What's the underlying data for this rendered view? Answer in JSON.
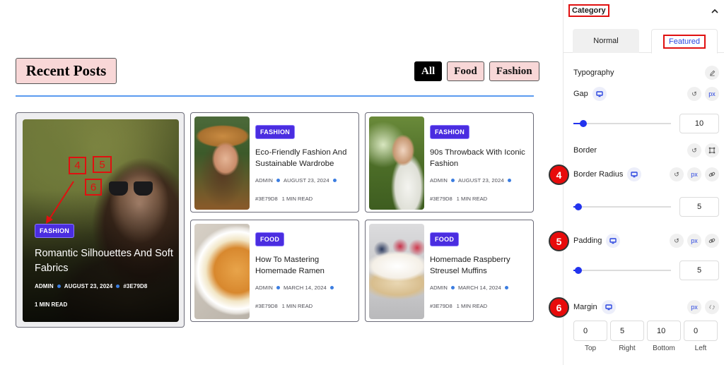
{
  "preview": {
    "heading": "Recent Posts",
    "filters": [
      {
        "label": "All",
        "active": true
      },
      {
        "label": "Food",
        "active": false
      },
      {
        "label": "Fashion",
        "active": false
      }
    ],
    "accent_color": "#5b9bf0",
    "tag_color": "#4a2de0",
    "featured_post": {
      "category": "FASHION",
      "title": "Romantic Silhouettes And Soft Fabrics",
      "author": "ADMIN",
      "date": "AUGUST 23, 2024",
      "color_code": "#3E79D8",
      "read_time": "1 MIN READ",
      "annotations": [
        "4",
        "5",
        "6"
      ]
    },
    "posts": [
      {
        "category": "FASHION",
        "title": "Eco-Friendly Fashion And Sustainable Wardrobe",
        "author": "ADMIN",
        "date": "AUGUST 23, 2024",
        "color_code": "#3E79D8",
        "read_time": "1 MIN READ"
      },
      {
        "category": "FASHION",
        "title": "90s Throwback With Iconic Fashion",
        "author": "ADMIN",
        "date": "AUGUST 23, 2024",
        "color_code": "#3E79D8",
        "read_time": "1 MIN READ"
      },
      {
        "category": "FOOD",
        "title": "How To Mastering Homemade Ramen",
        "author": "ADMIN",
        "date": "MARCH 14, 2024",
        "color_code": "#3E79D8",
        "read_time": "1 MIN READ"
      },
      {
        "category": "FOOD",
        "title": "Homemade Raspberry Streusel Muffins",
        "author": "ADMIN",
        "date": "MARCH 14, 2024",
        "color_code": "#3E79D8",
        "read_time": "1 MIN READ"
      }
    ]
  },
  "panel": {
    "section_title": "Category",
    "collapse_icon": "chevron-up-icon",
    "tabs": [
      {
        "label": "Normal",
        "active": false
      },
      {
        "label": "Featured",
        "active": true
      }
    ],
    "typography_label": "Typography",
    "gap": {
      "label": "Gap",
      "unit": "px",
      "value": "10",
      "slider_fraction": 0.1
    },
    "border_label": "Border",
    "border_radius": {
      "label": "Border Radius",
      "unit": "px",
      "value": "5",
      "slider_fraction": 0.05,
      "badge": "4"
    },
    "padding": {
      "label": "Padding",
      "unit": "px",
      "value": "5",
      "slider_fraction": 0.05,
      "badge": "5"
    },
    "margin": {
      "label": "Margin",
      "unit": "px",
      "badge": "6",
      "values": [
        {
          "caption": "Top",
          "value": "0"
        },
        {
          "caption": "Right",
          "value": "5"
        },
        {
          "caption": "Bottom",
          "value": "10"
        },
        {
          "caption": "Left",
          "value": "0"
        }
      ]
    }
  }
}
